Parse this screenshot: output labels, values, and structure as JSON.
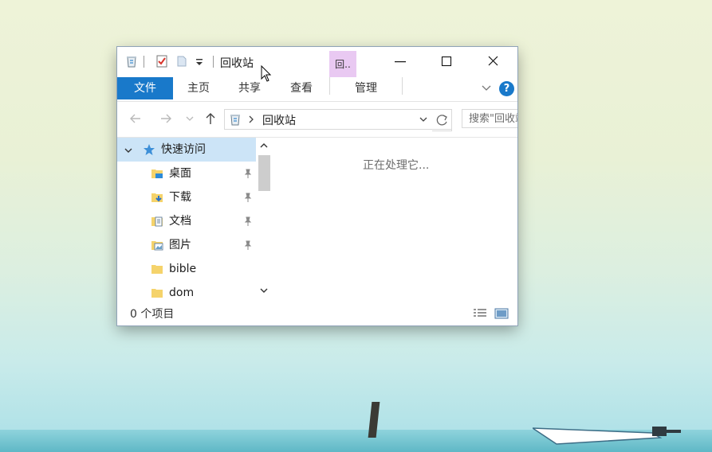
{
  "window": {
    "title": "回收站",
    "context_tab_header": "回..",
    "quick_access_toolbar": [
      "recycle-bin-icon",
      "properties-check-icon",
      "new-folder-icon",
      "customize-dropdown-icon"
    ]
  },
  "ribbon": {
    "tabs": [
      {
        "label": "文件",
        "active": true
      },
      {
        "label": "主页"
      },
      {
        "label": "共享"
      },
      {
        "label": "查看"
      },
      {
        "label": "管理"
      }
    ],
    "help_label": "?"
  },
  "navigation": {
    "address_path": "回收站",
    "search_placeholder": "搜索\"回收站\""
  },
  "nav_pane": {
    "items": [
      {
        "label": "快速访问",
        "icon": "star-icon",
        "expanded": true,
        "selected": true
      },
      {
        "label": "桌面",
        "icon": "desktop-folder-icon",
        "pinned": true
      },
      {
        "label": "下载",
        "icon": "download-folder-icon",
        "pinned": true
      },
      {
        "label": "文档",
        "icon": "documents-folder-icon",
        "pinned": true
      },
      {
        "label": "图片",
        "icon": "pictures-folder-icon",
        "pinned": true
      },
      {
        "label": "bible",
        "icon": "folder-icon"
      },
      {
        "label": "dom",
        "icon": "folder-icon"
      }
    ]
  },
  "content": {
    "message": "正在处理它..."
  },
  "status_bar": {
    "item_count": "0 个项目"
  },
  "colors": {
    "accent": "#1979ca",
    "selection": "#cce4f7",
    "context_tab": "#e9c9f2"
  }
}
